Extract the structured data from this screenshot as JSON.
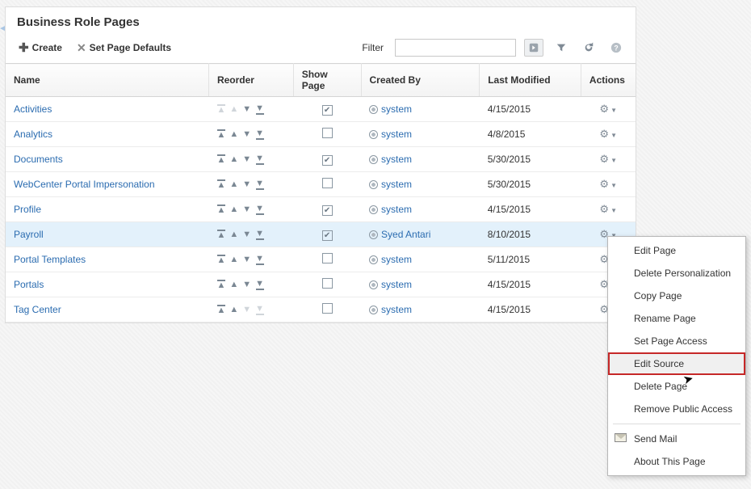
{
  "title": "Business Role Pages",
  "toolbar": {
    "create": "Create",
    "defaults": "Set Page Defaults",
    "filter_label": "Filter",
    "filter_value": ""
  },
  "columns": {
    "name": "Name",
    "reorder": "Reorder",
    "show": "Show Page",
    "created": "Created By",
    "modified": "Last Modified",
    "actions": "Actions"
  },
  "rows": [
    {
      "name": "Activities",
      "created": "system",
      "modified": "4/15/2015",
      "show": true,
      "first": true,
      "sel": false
    },
    {
      "name": "Analytics",
      "created": "system",
      "modified": "4/8/2015",
      "show": false,
      "sel": false
    },
    {
      "name": "Documents",
      "created": "system",
      "modified": "5/30/2015",
      "show": true,
      "sel": false
    },
    {
      "name": "WebCenter Portal Impersonation",
      "created": "system",
      "modified": "5/30/2015",
      "show": false,
      "sel": false
    },
    {
      "name": "Profile",
      "created": "system",
      "modified": "4/15/2015",
      "show": true,
      "sel": false
    },
    {
      "name": "Payroll",
      "created": "Syed Antari",
      "modified": "8/10/2015",
      "show": true,
      "sel": true
    },
    {
      "name": "Portal Templates",
      "created": "system",
      "modified": "5/11/2015",
      "show": false,
      "sel": false
    },
    {
      "name": "Portals",
      "created": "system",
      "modified": "4/15/2015",
      "show": false,
      "sel": false
    },
    {
      "name": "Tag Center",
      "created": "system",
      "modified": "4/15/2015",
      "show": false,
      "last": true,
      "sel": false
    }
  ],
  "menu": {
    "edit_page": "Edit Page",
    "delete_personalization": "Delete Personalization",
    "copy_page": "Copy Page",
    "rename_page": "Rename Page",
    "set_page_access": "Set Page Access",
    "edit_source": "Edit Source",
    "delete_page": "Delete Page",
    "remove_public_access": "Remove Public Access",
    "send_mail": "Send Mail",
    "about": "About This Page"
  }
}
